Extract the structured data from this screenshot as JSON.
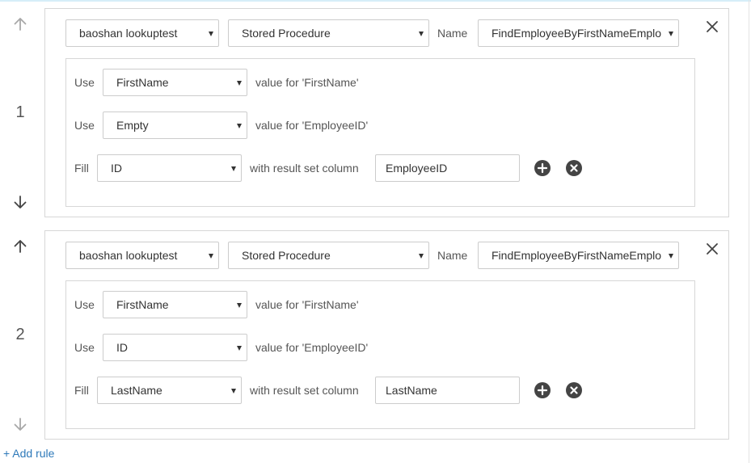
{
  "rules": [
    {
      "number": "1",
      "datasource": "baoshan lookuptest",
      "type": "Stored Procedure",
      "name_label": "Name",
      "name_value": "FindEmployeeByFirstNameEmplo",
      "params": [
        {
          "prefix": "Use",
          "value": "FirstName",
          "suffix": "value for 'FirstName'"
        },
        {
          "prefix": "Use",
          "value": "Empty",
          "suffix": "value for 'EmployeeID'"
        }
      ],
      "fill": {
        "prefix": "Fill",
        "value": "ID",
        "middle": "with result set column",
        "column": "EmployeeID"
      }
    },
    {
      "number": "2",
      "datasource": "baoshan lookuptest",
      "type": "Stored Procedure",
      "name_label": "Name",
      "name_value": "FindEmployeeByFirstNameEmplo",
      "params": [
        {
          "prefix": "Use",
          "value": "FirstName",
          "suffix": "value for 'FirstName'"
        },
        {
          "prefix": "Use",
          "value": "ID",
          "suffix": "value for 'EmployeeID'"
        }
      ],
      "fill": {
        "prefix": "Fill",
        "value": "LastName",
        "middle": "with result set column",
        "column": "LastName"
      }
    }
  ],
  "add_rule_label": "+ Add rule",
  "icons": {
    "up": "arrow-up-icon",
    "down": "arrow-down-icon",
    "close": "close-icon",
    "add": "plus-circle-icon",
    "remove": "x-circle-icon"
  },
  "colors": {
    "link": "#2e79b9",
    "border": "#d7d7d7",
    "icon_dark": "#444444"
  }
}
